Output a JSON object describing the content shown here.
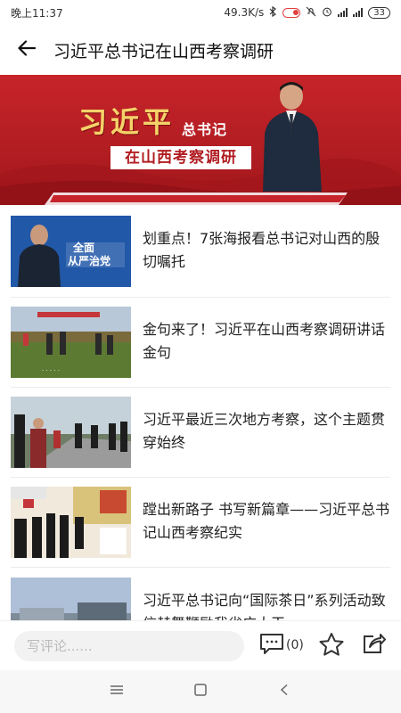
{
  "status_bar": {
    "time": "晚上11:37",
    "network_speed": "49.3K/s",
    "battery": "33"
  },
  "nav": {
    "title": "习近平总书记在山西考察调研",
    "back_icon": "arrow-left-icon"
  },
  "banner": {
    "name": "习近平",
    "rank": "总书记",
    "subtitle": "在山西考察调研"
  },
  "articles": [
    {
      "title": "划重点！7张海报看总书记对山西的殷切嘱托",
      "thumb_caption": "全面从严治党"
    },
    {
      "title": "金句来了！习近平在山西考察调研讲话金句"
    },
    {
      "title": "习近平最近三次地方考察，这个主题贯穿始终"
    },
    {
      "title": "蹚出新路子 书写新篇章——习近平总书记山西考察纪实"
    },
    {
      "title": "习近平总书记向“国际茶日”系列活动致信赫舞鞭励我省广大干"
    }
  ],
  "comment_bar": {
    "placeholder": "写评论......",
    "comment_count": "(0)",
    "icons": [
      "comment-icon",
      "star-icon",
      "share-icon"
    ]
  },
  "system_nav": {
    "icons": [
      "menu-icon",
      "home-icon",
      "back-icon"
    ]
  },
  "colors": {
    "brand_red": "#b11d22",
    "gold": "#f4d36a"
  }
}
